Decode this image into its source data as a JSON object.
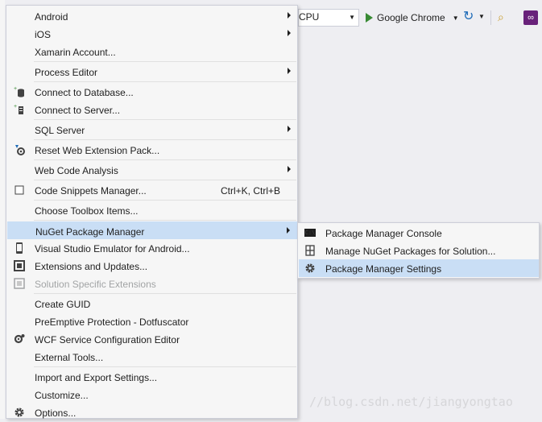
{
  "toolbar": {
    "config_value": "CPU",
    "run_target": "Google Chrome"
  },
  "menu": {
    "items": [
      {
        "label": "Android",
        "submenu": true
      },
      {
        "label": "iOS",
        "submenu": true
      },
      {
        "label": "Xamarin Account..."
      },
      {
        "label": "Process Editor",
        "submenu": true
      },
      {
        "label": "Connect to Database...",
        "icon": "database-icon"
      },
      {
        "label": "Connect to Server...",
        "icon": "server-icon"
      },
      {
        "label": "SQL Server",
        "submenu": true
      },
      {
        "label": "Reset Web Extension Pack...",
        "icon": "reset-icon"
      },
      {
        "label": "Web Code Analysis",
        "submenu": true
      },
      {
        "label": "Code Snippets Manager...",
        "shortcut": "Ctrl+K, Ctrl+B",
        "icon": "checkbox-icon"
      },
      {
        "label": "Choose Toolbox Items..."
      },
      {
        "label": "NuGet Package Manager",
        "submenu": true,
        "highlighted": true
      },
      {
        "label": "Visual Studio Emulator for Android...",
        "icon": "phone-icon"
      },
      {
        "label": "Extensions and Updates...",
        "icon": "extensions-icon"
      },
      {
        "label": "Solution Specific Extensions",
        "disabled": true,
        "icon": "solution-ext-icon"
      },
      {
        "label": "Create GUID"
      },
      {
        "label": "PreEmptive Protection - Dotfuscator"
      },
      {
        "label": "WCF Service Configuration Editor",
        "icon": "wcf-gear-icon"
      },
      {
        "label": "External Tools..."
      },
      {
        "label": "Import and Export Settings..."
      },
      {
        "label": "Customize..."
      },
      {
        "label": "Options...",
        "icon": "gear-icon"
      }
    ]
  },
  "submenu": {
    "items": [
      {
        "label": "Package Manager Console",
        "icon": "console-icon"
      },
      {
        "label": "Manage NuGet Packages for Solution...",
        "icon": "packages-icon"
      },
      {
        "label": "Package Manager Settings",
        "icon": "gear-icon",
        "highlighted": true
      }
    ]
  },
  "watermark": "//blog.csdn.net/jiangyongtao",
  "colors": {
    "highlight": "#c9def5",
    "menu_bg": "#f6f6f6",
    "disabled_text": "#a2a4a5",
    "run_green": "#388a34"
  }
}
